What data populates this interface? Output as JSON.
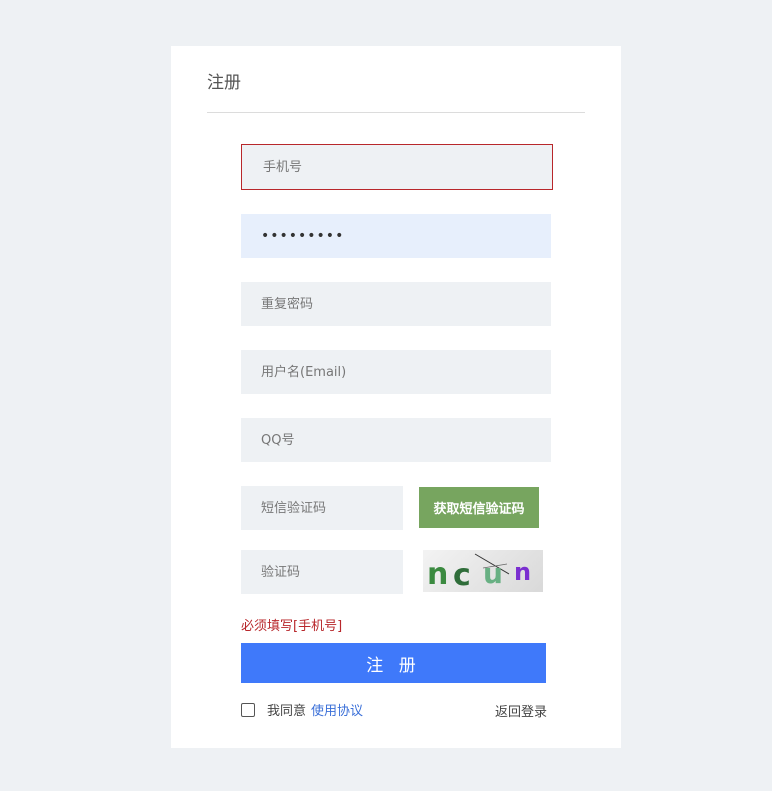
{
  "form": {
    "title": "注册",
    "fields": [
      {
        "placeholder": "手机号",
        "value": ""
      },
      {
        "placeholder": "",
        "value": "•••••••••"
      },
      {
        "placeholder": "重复密码",
        "value": ""
      },
      {
        "placeholder": "用户名(Email)",
        "value": ""
      },
      {
        "placeholder": "QQ号",
        "value": ""
      },
      {
        "placeholder": "短信验证码",
        "value": ""
      },
      {
        "placeholder": "验证码",
        "value": ""
      }
    ],
    "sms_button": "获取短信验证码",
    "captcha_text": "ncun",
    "error_message": "必须填写[手机号]",
    "submit_label": "注 册",
    "agree_text": "我同意",
    "agreement_link": "使用协议",
    "back_login": "返回登录"
  },
  "colors": {
    "background": "#eef1f4",
    "card": "#ffffff",
    "error": "#b8272b",
    "primary": "#3f79fa",
    "sms_button": "#77a55f",
    "link": "#3a6fd8"
  }
}
